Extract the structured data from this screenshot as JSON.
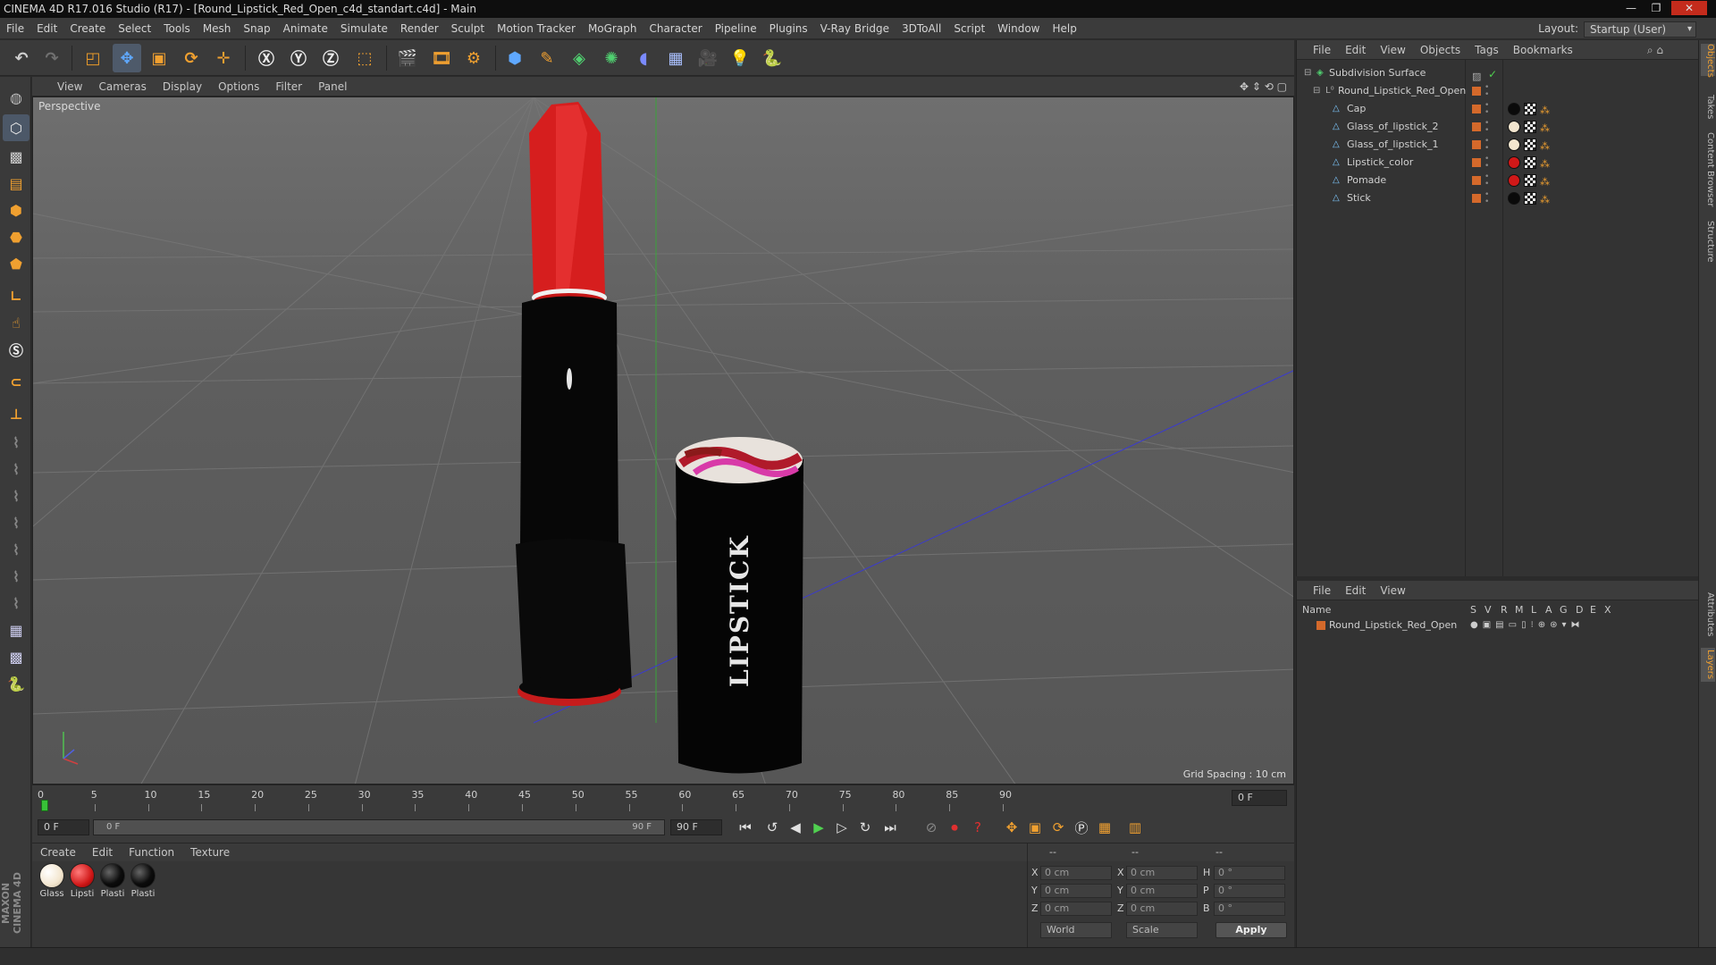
{
  "window": {
    "title": "CINEMA 4D R17.016 Studio (R17) - [Round_Lipstick_Red_Open_c4d_standart.c4d] - Main"
  },
  "menu": [
    "File",
    "Edit",
    "Create",
    "Select",
    "Tools",
    "Mesh",
    "Snap",
    "Animate",
    "Simulate",
    "Render",
    "Sculpt",
    "Motion Tracker",
    "MoGraph",
    "Character",
    "Pipeline",
    "Plugins",
    "V-Ray Bridge",
    "3DToAll",
    "Script",
    "Window",
    "Help"
  ],
  "layout": {
    "label": "Layout:",
    "value": "Startup (User)"
  },
  "viewport": {
    "menu": [
      "View",
      "Cameras",
      "Display",
      "Options",
      "Filter",
      "Panel"
    ],
    "label": "Perspective",
    "grid_spacing": "Grid Spacing : 10 cm",
    "cap_text": "LIPSTICK"
  },
  "timeline": {
    "ticks": [
      "0",
      "5",
      "10",
      "15",
      "20",
      "25",
      "30",
      "35",
      "40",
      "45",
      "50",
      "55",
      "60",
      "65",
      "70",
      "75",
      "80",
      "85",
      "90"
    ],
    "current_frame": "0 F",
    "start_field": "0 F",
    "range_start": "0 F",
    "range_end": "90 F",
    "end_field": "90 F"
  },
  "materials": {
    "menu": [
      "Create",
      "Edit",
      "Function",
      "Texture"
    ],
    "items": [
      {
        "label": "Glass",
        "color": "#f3e6cf"
      },
      {
        "label": "Lipsti",
        "color": "#d01818"
      },
      {
        "label": "Plasti",
        "color": "#0c0c0c"
      },
      {
        "label": "Plasti",
        "color": "#0c0c0c"
      }
    ]
  },
  "coordinates": {
    "header": [
      "--",
      "--",
      "--"
    ],
    "rows": [
      {
        "a": "X",
        "av": "0 cm",
        "b": "X",
        "bv": "0 cm",
        "c": "H",
        "cv": "0 °"
      },
      {
        "a": "Y",
        "av": "0 cm",
        "b": "Y",
        "bv": "0 cm",
        "c": "P",
        "cv": "0 °"
      },
      {
        "a": "Z",
        "av": "0 cm",
        "b": "Z",
        "bv": "0 cm",
        "c": "B",
        "cv": "0 °"
      }
    ],
    "space": "World",
    "mode": "Scale",
    "apply": "Apply"
  },
  "object_manager": {
    "menu": [
      "File",
      "Edit",
      "View",
      "Objects",
      "Tags",
      "Bookmarks"
    ],
    "objects": [
      {
        "name": "Subdivision Surface",
        "tag": ""
      },
      {
        "name": "Round_Lipstick_Red_Open",
        "tag": ""
      },
      {
        "name": "Cap",
        "tag": "#0a0a0a"
      },
      {
        "name": "Glass_of_lipstick_2",
        "tag": "#f3e6cf"
      },
      {
        "name": "Glass_of_lipstick_1",
        "tag": "#f3e6cf"
      },
      {
        "name": "Lipstick_color",
        "tag": "#d01818"
      },
      {
        "name": "Pomade",
        "tag": "#d01818"
      },
      {
        "name": "Stick",
        "tag": "#0a0a0a"
      }
    ]
  },
  "layer_manager": {
    "menu": [
      "File",
      "Edit",
      "View"
    ],
    "columns": [
      "Name",
      "S",
      "V",
      "R",
      "M",
      "L",
      "A",
      "G",
      "D",
      "E",
      "X"
    ],
    "layers": [
      {
        "name": "Round_Lipstick_Red_Open"
      }
    ]
  },
  "right_tabs": [
    "Objects",
    "Takes",
    "Content Browser",
    "Structure",
    "Attributes",
    "Layers"
  ],
  "brand": "MAXON CINEMA 4D"
}
